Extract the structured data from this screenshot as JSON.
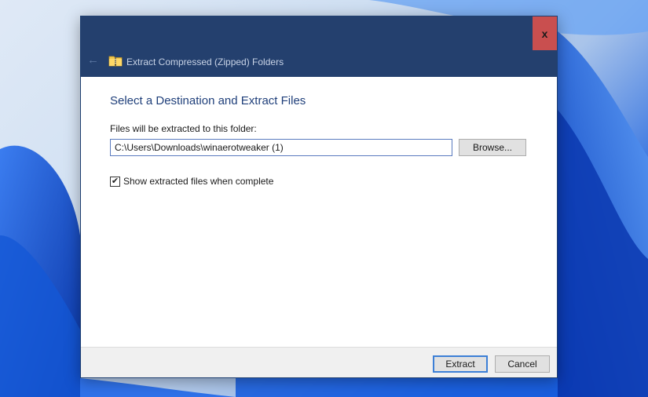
{
  "window": {
    "title": "Extract Compressed (Zipped) Folders",
    "close_label": "x"
  },
  "main": {
    "heading": "Select a Destination and Extract Files",
    "destination_label": "Files will be extracted to this folder:",
    "destination_path": "C:\\Users\\Downloads\\winaerotweaker (1)",
    "browse_label": "Browse...",
    "show_files_label": "Show extracted files when complete",
    "show_files_checked": true
  },
  "footer": {
    "extract_label": "Extract",
    "cancel_label": "Cancel"
  },
  "icons": {
    "back": "back-arrow-icon",
    "folder": "zipped-folder-icon",
    "close": "close-icon",
    "check": "checkmark-icon"
  },
  "colors": {
    "titlebar": "#24406e",
    "close_button": "#c94f4f",
    "heading": "#1f3f7a"
  }
}
